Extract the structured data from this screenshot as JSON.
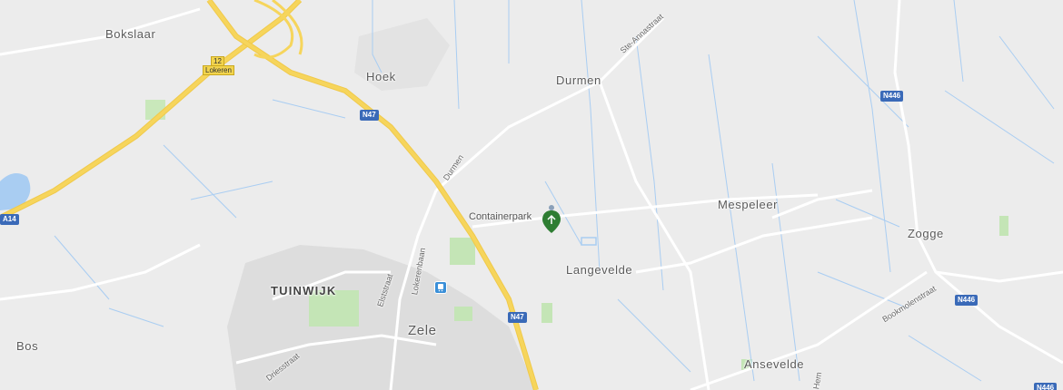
{
  "map": {
    "places": {
      "bokslaar": "Bokslaar",
      "hoek": "Hoek",
      "durmen": "Durmen",
      "mespeleer": "Mespeleer",
      "zogge": "Zogge",
      "langevelde": "Langevelde",
      "tuinwijk": "TUINWIJK",
      "zele": "Zele",
      "bos": "Bos",
      "ansevelde": "Ansevelde"
    },
    "streets": {
      "ste_annastraat": "Ste-Annastraat",
      "durmen": "Durmen",
      "elststraat": "Elststraat",
      "lokerenbaan": "Lokerenbaan",
      "driesstraat": "Driesstraat",
      "bookmolenstraat": "Bookmolenstraat",
      "hem": "Hem"
    },
    "shields": {
      "n47_top": "N47",
      "n47_bottom": "N47",
      "n446_top": "N446",
      "n446_right": "N446",
      "a14": "A14",
      "e12_number": "12",
      "e12_label": "Lokeren",
      "bottom_right_partial": "N446"
    },
    "poi": {
      "label": "Containerpark",
      "icon": "recycling-pin-icon",
      "color": "#2e7d32"
    },
    "colors": {
      "background": "#ececec",
      "motorway": "#f6d55c",
      "road": "#ffffff",
      "water": "#a9cdf2",
      "park": "#c4e5b6",
      "urban": "#dcdcdc",
      "shield": "#3a6ab8"
    }
  }
}
